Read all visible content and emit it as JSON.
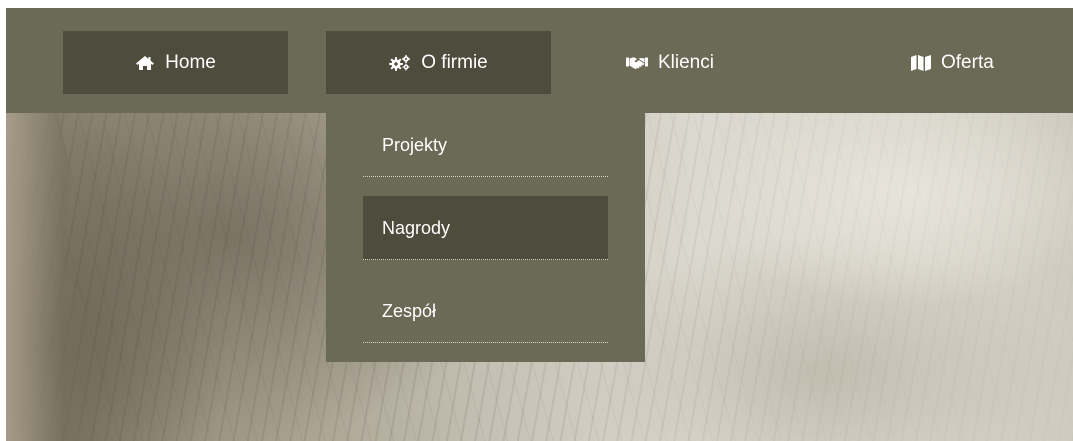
{
  "colors": {
    "bar": "#6b6a57",
    "active": "#4d4c3d",
    "text": "#ffffff"
  },
  "nav": {
    "items": [
      {
        "label": "Home",
        "icon": "home-icon"
      },
      {
        "label": "O firmie",
        "icon": "gears-icon"
      },
      {
        "label": "Klienci",
        "icon": "handshake-icon"
      },
      {
        "label": "Oferta",
        "icon": "map-icon"
      }
    ]
  },
  "dropdown": {
    "items": [
      {
        "label": "Projekty"
      },
      {
        "label": "Nagrody"
      },
      {
        "label": "Zespół"
      }
    ]
  }
}
